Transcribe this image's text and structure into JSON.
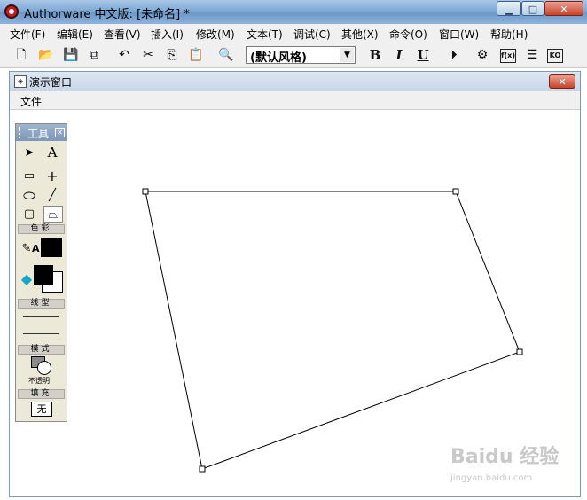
{
  "window": {
    "title": "Authorware 中文版: [未命名] *"
  },
  "menubar": {
    "items": [
      "文件(F)",
      "编辑(E)",
      "查看(V)",
      "插入(I)",
      "修改(M)",
      "文本(T)",
      "调试(C)",
      "其他(X)",
      "命令(O)",
      "窗口(W)",
      "帮助(H)"
    ]
  },
  "toolbar": {
    "style_select": "(默认风格)",
    "buttons": [
      "new-icon",
      "open-icon",
      "save-all-icon",
      "import-icon",
      "undo-icon",
      "cut-icon",
      "copy-icon",
      "paste-icon",
      "find-icon",
      "bold-icon",
      "italic-icon",
      "underline-icon",
      "run-icon",
      "control-panel-icon",
      "functions-icon",
      "variables-icon",
      "knowledge-objects-icon"
    ],
    "bold_label": "B",
    "italic_label": "I",
    "underline_label": "U",
    "functions_label": "f(x)",
    "knowledge_label": "KO"
  },
  "presentation_window": {
    "title": "演示窗口",
    "menu": [
      "文件"
    ]
  },
  "toolbox": {
    "title": "工具",
    "text_tool_label": "A",
    "color_section": "色彩",
    "line_section": "线型",
    "mode_section": "模式",
    "mode_value": "不透明",
    "fill_section": "填充",
    "fill_value": "无",
    "color_text_label": "A"
  },
  "watermark": {
    "main": "Baidu 经验",
    "sub": "jingyan.baidu.com"
  },
  "colors": {
    "titlebar": "#7fa9d6",
    "close": "#c8422c",
    "toolbox": "#ece9d8"
  }
}
